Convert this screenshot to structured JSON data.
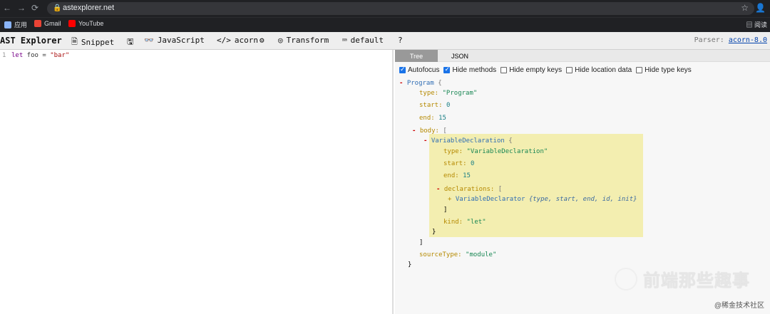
{
  "browser": {
    "url": "astexplorer.net",
    "bookmarks": [
      "应用",
      "Gmail",
      "YouTube"
    ],
    "reading_list": "阅读",
    "nav_back": "←",
    "nav_forward": "→",
    "nav_reload": "⟳",
    "star": "☆",
    "profile": "👤"
  },
  "toolbar": {
    "title": "AST Explorer",
    "snippet": "Snippet",
    "language": "JavaScript",
    "parser": "acorn",
    "transform": "Transform",
    "default": "default",
    "help": "?",
    "parser_label": "Parser:",
    "parser_link": "acorn-8.0"
  },
  "editor": {
    "line_number": "1",
    "code_keyword": "let",
    "code_ident": " foo = ",
    "code_string": "\"bar\""
  },
  "panel": {
    "tabs": [
      "Tree",
      "JSON"
    ],
    "options": [
      {
        "label": "Autofocus",
        "checked": true
      },
      {
        "label": "Hide methods",
        "checked": true
      },
      {
        "label": "Hide empty keys",
        "checked": false
      },
      {
        "label": "Hide location data",
        "checked": false
      },
      {
        "label": "Hide type keys",
        "checked": false
      }
    ],
    "tree": {
      "program": "Program",
      "type_key": "type:",
      "type_program": "\"Program\"",
      "start_key": "start:",
      "start_0": "0",
      "end_key": "end:",
      "end_15": "15",
      "body_key": "body:",
      "var_decl": "VariableDeclaration",
      "type_var_decl": "\"VariableDeclaration\"",
      "declarations_key": "declarations:",
      "var_declarator": "VariableDeclarator",
      "declarator_meta": "{type, start, end, id, init}",
      "kind_key": "kind:",
      "kind_let": "\"let\"",
      "sourceType_key": "sourceType:",
      "sourceType_module": "\"module\"",
      "brace_open": "{",
      "brace_close": "}",
      "bracket_open": "[",
      "bracket_close": "]",
      "minus": "-",
      "plus": "+"
    }
  },
  "watermark": {
    "text": "前端那些趣事",
    "credit": "@稀金技术社区"
  },
  "colors": {
    "highlight": "#f3eeb0",
    "node_blue": "#2f6db4",
    "key_gold": "#b58900",
    "string_green": "#198754"
  }
}
